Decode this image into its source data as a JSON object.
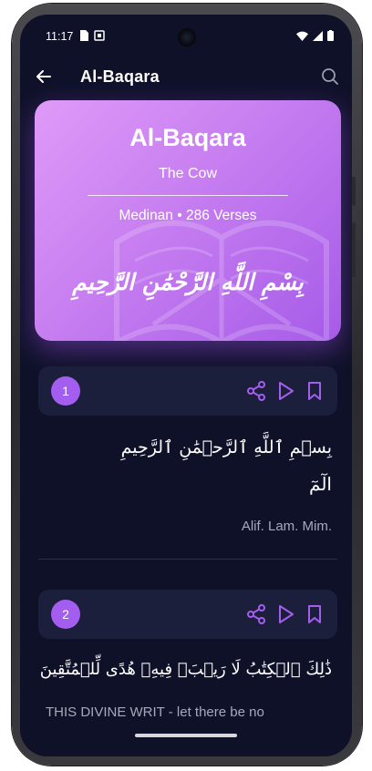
{
  "status_bar": {
    "time": "11:17"
  },
  "app_bar": {
    "title": "Al-Baqara"
  },
  "surah": {
    "name": "Al-Baqara",
    "translation": "The Cow",
    "meta": "Medinan • 286 Verses",
    "bismillah": "بِسْمِ اللَّهِ الرَّحْمَٰنِ الرَّحِيمِ"
  },
  "verses": [
    {
      "number": "1",
      "arabic_line1": "بِسۡمِ ٱللَّهِ ٱلرَّحۡمَٰنِ ٱلرَّحِيمِ",
      "arabic_line2": "الٓمٓ",
      "translation": "Alif. Lam. Mim."
    },
    {
      "number": "2",
      "arabic_line1": "ذَٰلِكَ ٱلۡكِتَٰبُ لَا رَيۡبَۛ فِيهِۛ هُدًى لِّلۡمُتَّقِينَ",
      "translation": "THIS DIVINE WRIT - let there be no"
    }
  ],
  "icons": {
    "back": "arrow-left-icon",
    "search": "search-icon",
    "share": "share-icon",
    "play": "play-icon",
    "bookmark": "bookmark-icon"
  },
  "colors": {
    "background": "#0f1129",
    "card": "#1c1f3c",
    "accent": "#a35ef0",
    "hero_start": "#df9af8",
    "hero_end": "#a65be8"
  }
}
